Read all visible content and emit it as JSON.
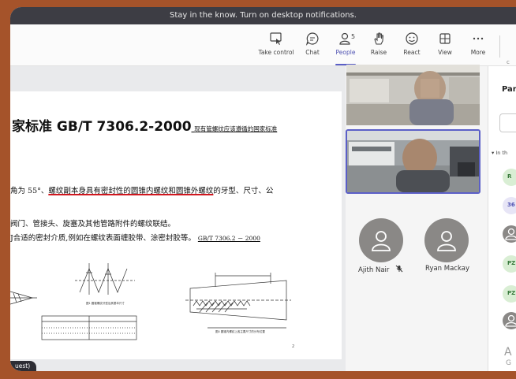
{
  "notification": {
    "text": "Stay in the know. Turn on desktop notifications."
  },
  "toolbar": {
    "take_control": "Take control",
    "chat": "Chat",
    "people": "People",
    "people_count": "5",
    "raise": "Raise",
    "react": "React",
    "view": "View",
    "more": "More"
  },
  "shared_document": {
    "title": "家标准 GB/T 7306.2-2000",
    "title_note": "_现有管螺纹应该遵循的国家标准",
    "line1_pre": "角为 55°、",
    "line1_highlight": "螺纹副本身具有密封性的圆锥内螺纹和圆锥外螺纹",
    "line1_post": "的牙型、尺寸、公",
    "line2": "阀门、管接头、旋塞及其他管路附件的螺纹联结。",
    "line3_pre": "J合适的密封介质,例如在螺纹表面缠胶带、涂密封胶等。",
    "line3_ref": "GB/T 7306.2 － 2000",
    "page_number": "2"
  },
  "guest_label": "uest)",
  "participants": [
    {
      "name": "Ajith Nair",
      "muted": true
    },
    {
      "name": "Ryan Mackay",
      "muted": false
    }
  ],
  "panel": {
    "title": "Par",
    "section": "▾ In th",
    "avatars": [
      "R",
      "36",
      "",
      "PZ",
      "PZ",
      ""
    ],
    "cut_text_large": "A",
    "cut_text_small": "G"
  },
  "colors": {
    "accent": "#5b5fc7",
    "frame": "#a5532a",
    "highlight_underline": "#d0161e"
  }
}
